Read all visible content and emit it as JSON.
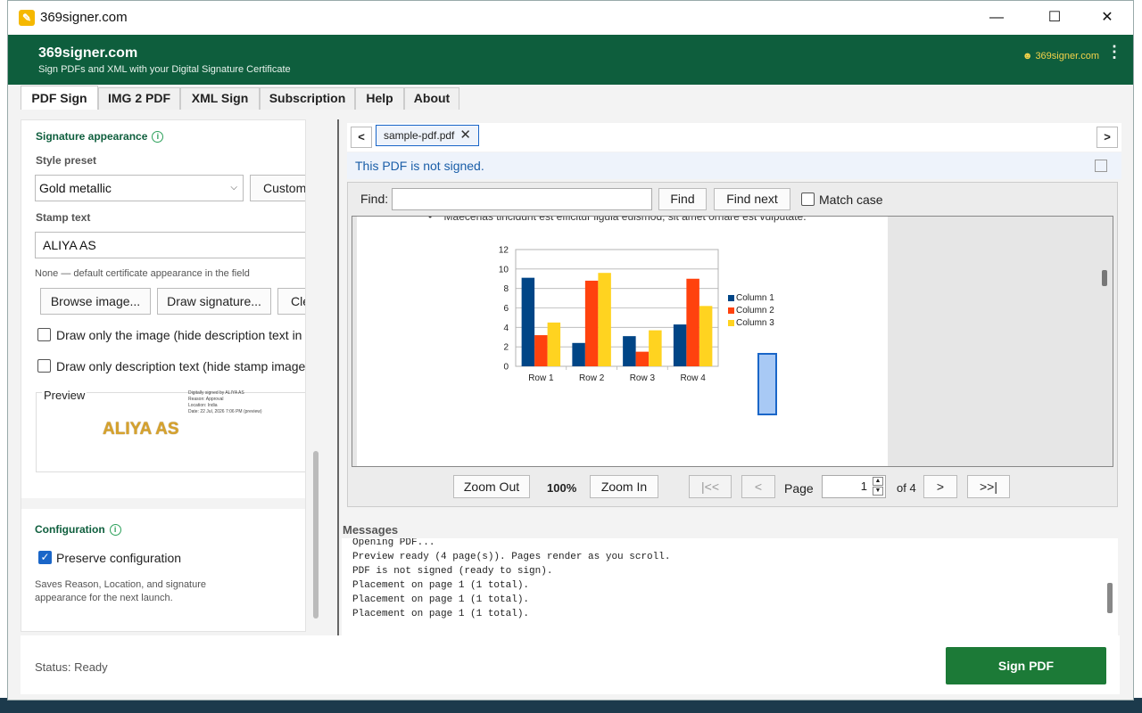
{
  "window": {
    "title": "369signer.com",
    "controls": {
      "minimize": "—",
      "maximize": "☐",
      "close": "✕"
    }
  },
  "header": {
    "app_name": "369signer.com",
    "tagline": "Sign PDFs and XML with your Digital Signature Certificate",
    "link": "☻ 369signer.com",
    "menu": "⋮"
  },
  "tabs": [
    "PDF Sign",
    "IMG 2 PDF",
    "XML Sign",
    "Subscription",
    "Help",
    "About"
  ],
  "signature": {
    "section_title": "Signature appearance",
    "style_label": "Style preset",
    "style_value": "Gold metallic",
    "customize": "Customi",
    "stamp_label": "Stamp text",
    "stamp_value": "ALIYA AS",
    "hint": "None — default certificate appearance in the field",
    "browse": "Browse image...",
    "draw": "Draw signature...",
    "clear": "Cle",
    "only_image": "Draw only the image (hide description text in the",
    "only_desc": "Draw only description text (hide stamp image / V",
    "preview_label": "Preview",
    "preview_stamp": "ALIYA AS",
    "preview_lines": [
      "Digitally signed by ALIYA AS",
      "Reason: Approval",
      "Location: India",
      "Date: 22 Jul, 2026 7:06 PM (preview)"
    ]
  },
  "config": {
    "title": "Configuration",
    "preserve": "Preserve configuration",
    "hint": "Saves Reason, Location, and signature appearance for the next launch."
  },
  "viewer": {
    "nav_prev": "<",
    "nav_next": ">",
    "file_tab": "sample-pdf.pdf",
    "file_close": "✕",
    "not_signed": "This PDF is not signed.",
    "find_label": "Find:",
    "find_btn": "Find",
    "find_next": "Find next",
    "match_case": "Match case",
    "page_text": "Maecenas tincidunt est efficitur ligula euismod, sit amet ornare est vulputate.",
    "zoom_out": "Zoom Out",
    "zoom": "100%",
    "zoom_in": "Zoom In",
    "first": "|<<",
    "prev": "<",
    "page_label": "Page",
    "page_value": "1",
    "of": "of 4",
    "next": ">",
    "last": ">>|"
  },
  "messages": {
    "title": "Messages",
    "lines": [
      "Opening PDF...",
      "Preview ready (4 page(s)). Pages render as you scroll.",
      "PDF is not signed (ready to sign).",
      "Placement on page 1 (1 total).",
      "Placement on page 1 (1 total).",
      "Placement on page 1 (1 total)."
    ]
  },
  "status": "Status: Ready",
  "sign_button": "Sign PDF",
  "colors": {
    "brand": "#0e5e3d",
    "accent": "#1a66c8",
    "sign": "#1c7a37"
  },
  "chart_data": {
    "type": "bar",
    "categories": [
      "Row 1",
      "Row 2",
      "Row 3",
      "Row 4"
    ],
    "series": [
      {
        "name": "Column 1",
        "values": [
          9.1,
          2.4,
          3.1,
          4.3
        ],
        "color": "#004586"
      },
      {
        "name": "Column 2",
        "values": [
          3.2,
          8.8,
          1.5,
          9.0
        ],
        "color": "#ff420e"
      },
      {
        "name": "Column 3",
        "values": [
          4.5,
          9.6,
          3.7,
          6.2
        ],
        "color": "#ffd320"
      }
    ],
    "ylim": [
      0,
      12
    ],
    "yticks": [
      "0",
      "2",
      "4",
      "6",
      "8",
      "10",
      "12"
    ],
    "grid": true,
    "legend": "right"
  }
}
